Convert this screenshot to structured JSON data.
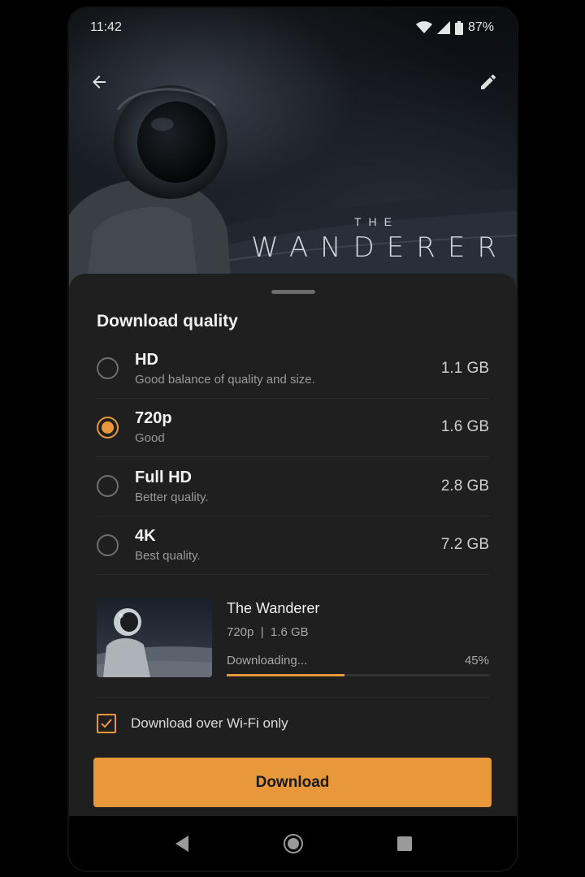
{
  "status_bar": {
    "time": "11:42",
    "battery": "87%"
  },
  "hero": {
    "poster_sup": "THE",
    "poster_title": "WANDERER"
  },
  "sheet": {
    "title": "Download quality",
    "options": [
      {
        "name": "HD",
        "description": "Good balance of quality and size.",
        "size": "1.1 GB",
        "selected": false
      },
      {
        "name": "720p",
        "description": "Good",
        "size": "1.6 GB",
        "selected": true
      },
      {
        "name": "Full HD",
        "description": "Better quality.",
        "size": "2.8 GB",
        "selected": false
      },
      {
        "name": "4K",
        "description": "Best quality.",
        "size": "7.2 GB",
        "selected": false
      }
    ],
    "download": {
      "title": "The Wanderer",
      "meta": "720p  |  1.6 GB",
      "status": "Downloading...",
      "percent_label": "45%",
      "progress": 0.45
    },
    "wifi_only": {
      "label": "Download over Wi-Fi only",
      "checked": true
    },
    "download_button": "Download"
  },
  "colors": {
    "accent": "#e8973a",
    "sheet_bg": "#1f1f1f"
  },
  "icons": [
    "back-arrow-icon",
    "edit-pencil-icon",
    "wifi-icon",
    "signal-icon",
    "battery-icon",
    "nav-back-icon",
    "nav-home-icon",
    "nav-recents-icon",
    "checkmark-icon"
  ]
}
